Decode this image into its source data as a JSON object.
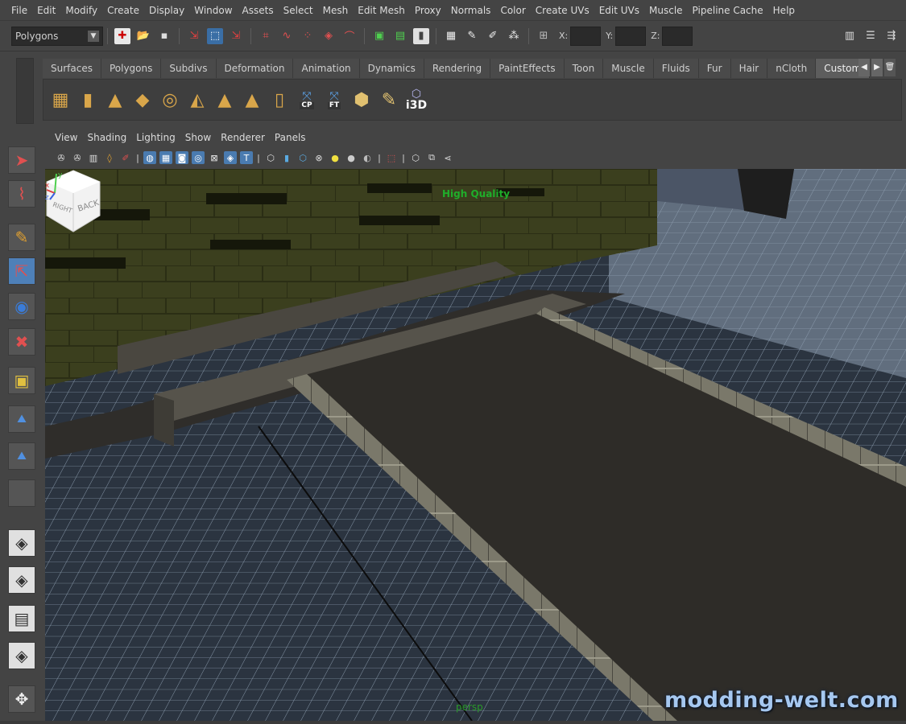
{
  "menubar": {
    "items": [
      "File",
      "Edit",
      "Modify",
      "Create",
      "Display",
      "Window",
      "Assets",
      "Select",
      "Mesh",
      "Edit Mesh",
      "Proxy",
      "Normals",
      "Color",
      "Create UVs",
      "Edit UVs",
      "Muscle",
      "Pipeline Cache",
      "Help"
    ]
  },
  "statusline": {
    "mode_menu": "Polygons",
    "x_label": "X:",
    "y_label": "Y:",
    "z_label": "Z:"
  },
  "shelf": {
    "tabs": [
      "Surfaces",
      "Polygons",
      "Subdivs",
      "Deformation",
      "Animation",
      "Dynamics",
      "Rendering",
      "PaintEffects",
      "Toon",
      "Muscle",
      "Fluids",
      "Fur",
      "Hair",
      "nCloth",
      "Custom"
    ],
    "active_tab": "Custom",
    "icon_labels": {
      "cp": "CP",
      "ft": "FT",
      "i3d": "i3D"
    }
  },
  "panel": {
    "menus": [
      "View",
      "Shading",
      "Lighting",
      "Show",
      "Renderer",
      "Panels"
    ]
  },
  "viewport": {
    "quality_label": "High Quality",
    "camera_label": "persp",
    "viewcube_faces": [
      "RIGHT",
      "BACK"
    ],
    "axis_labels": [
      "y",
      "x",
      "z"
    ]
  },
  "watermark": "modding-welt.com",
  "colors": {
    "ui_bg": "#444444",
    "viewport_grid": "#8a9aab",
    "floor": "#2e2c28",
    "wall_green": "#3b3f1e",
    "watermark": "#a6c8f0",
    "hq_label": "#1fae2a"
  }
}
